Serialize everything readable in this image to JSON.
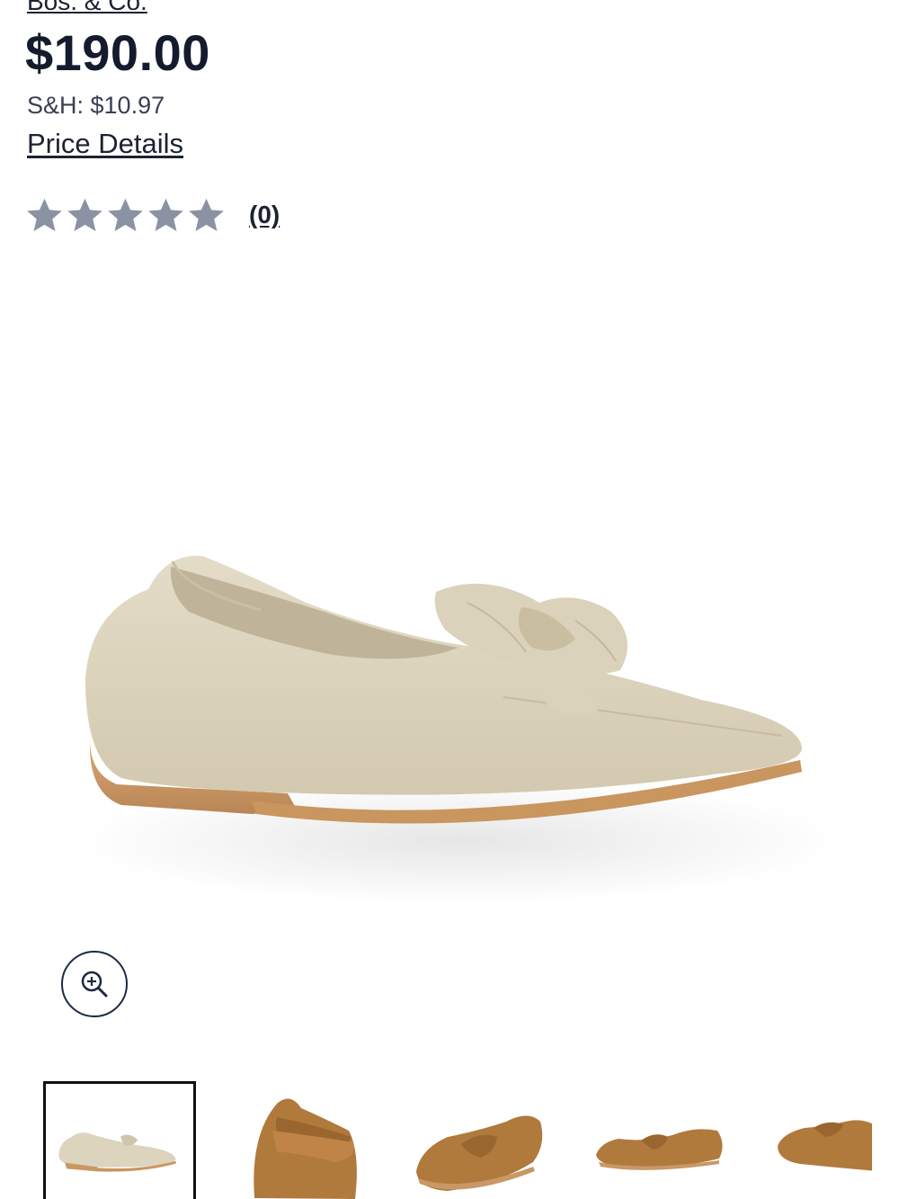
{
  "product": {
    "brand": "Bos. & Co.",
    "price": "$190.00",
    "shipping": "S&H: $10.97",
    "price_details_label": "Price Details"
  },
  "rating": {
    "stars": 0,
    "max_stars": 5,
    "review_count_label": "(0)"
  },
  "gallery": {
    "main_image": "beige-suede-loafer-with-bow",
    "zoom_icon": "zoom-in-icon",
    "selected_index": 0,
    "thumbnails": [
      "beige-loafer-side-view",
      "tan-loafer-bow-front-view",
      "tan-loafer-angled-view",
      "tan-loafer-side-view",
      "tan-loafer-partial-view"
    ]
  },
  "colors": {
    "text_primary": "#1c2233",
    "star_empty": "#8a92a3",
    "beige_suede": "#ddd5bf",
    "tan_suede": "#b07a3c",
    "sole": "#c89866"
  }
}
